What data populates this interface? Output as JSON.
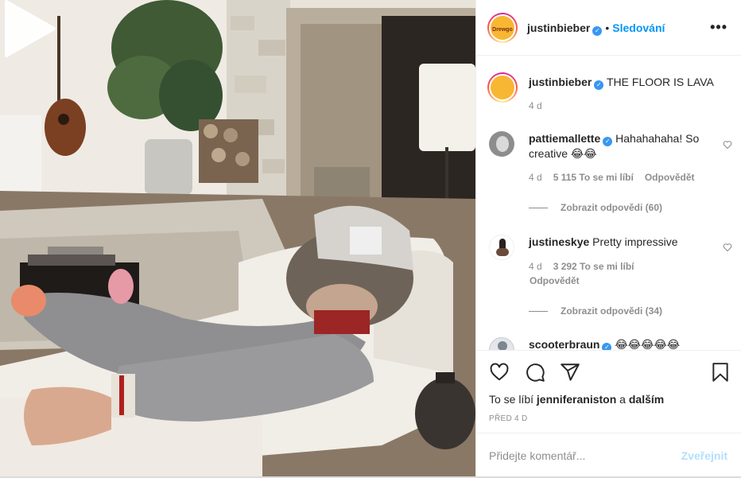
{
  "post": {
    "author": "justinbieber",
    "avatar_badge": "Drewgo",
    "follow_label": "Sledování",
    "more_label": "•••",
    "caption": "THE FLOOR IS LAVA",
    "caption_age": "4 d"
  },
  "comments": [
    {
      "user": "pattiemallette",
      "verified": true,
      "text": "Hahahahaha! So creative 😂😂",
      "age": "4 d",
      "likes": "5 115 To se mi líbí",
      "reply": "Odpovědět",
      "view_replies": "Zobrazit odpovědi (60)"
    },
    {
      "user": "justineskye",
      "verified": false,
      "text": "Pretty impressive",
      "age": "4 d",
      "likes": "3 292 To se mi líbí",
      "reply": "Odpovědět",
      "view_replies": "Zobrazit odpovědi (34)"
    },
    {
      "user": "scooterbraun",
      "verified": true,
      "text": "😂😂😂😂😂"
    }
  ],
  "actions": {
    "liked_by_prefix": "To se líbí",
    "liked_by_user": "jenniferaniston",
    "liked_by_and": "a",
    "liked_by_others": "dalším",
    "date": "PŘED 4 D"
  },
  "comment_box": {
    "placeholder": "Přidejte komentář...",
    "post_label": "Zveřejnit"
  },
  "icons": {
    "verified": "verified-badge-icon",
    "like": "heart-icon",
    "comment": "comment-icon",
    "share": "paper-plane-icon",
    "save": "bookmark-icon",
    "play": "play-icon"
  },
  "colors": {
    "accent": "#0095f6",
    "verified": "#3897f0",
    "muted": "#8e8e8e",
    "post_disabled": "#b2dffc"
  }
}
